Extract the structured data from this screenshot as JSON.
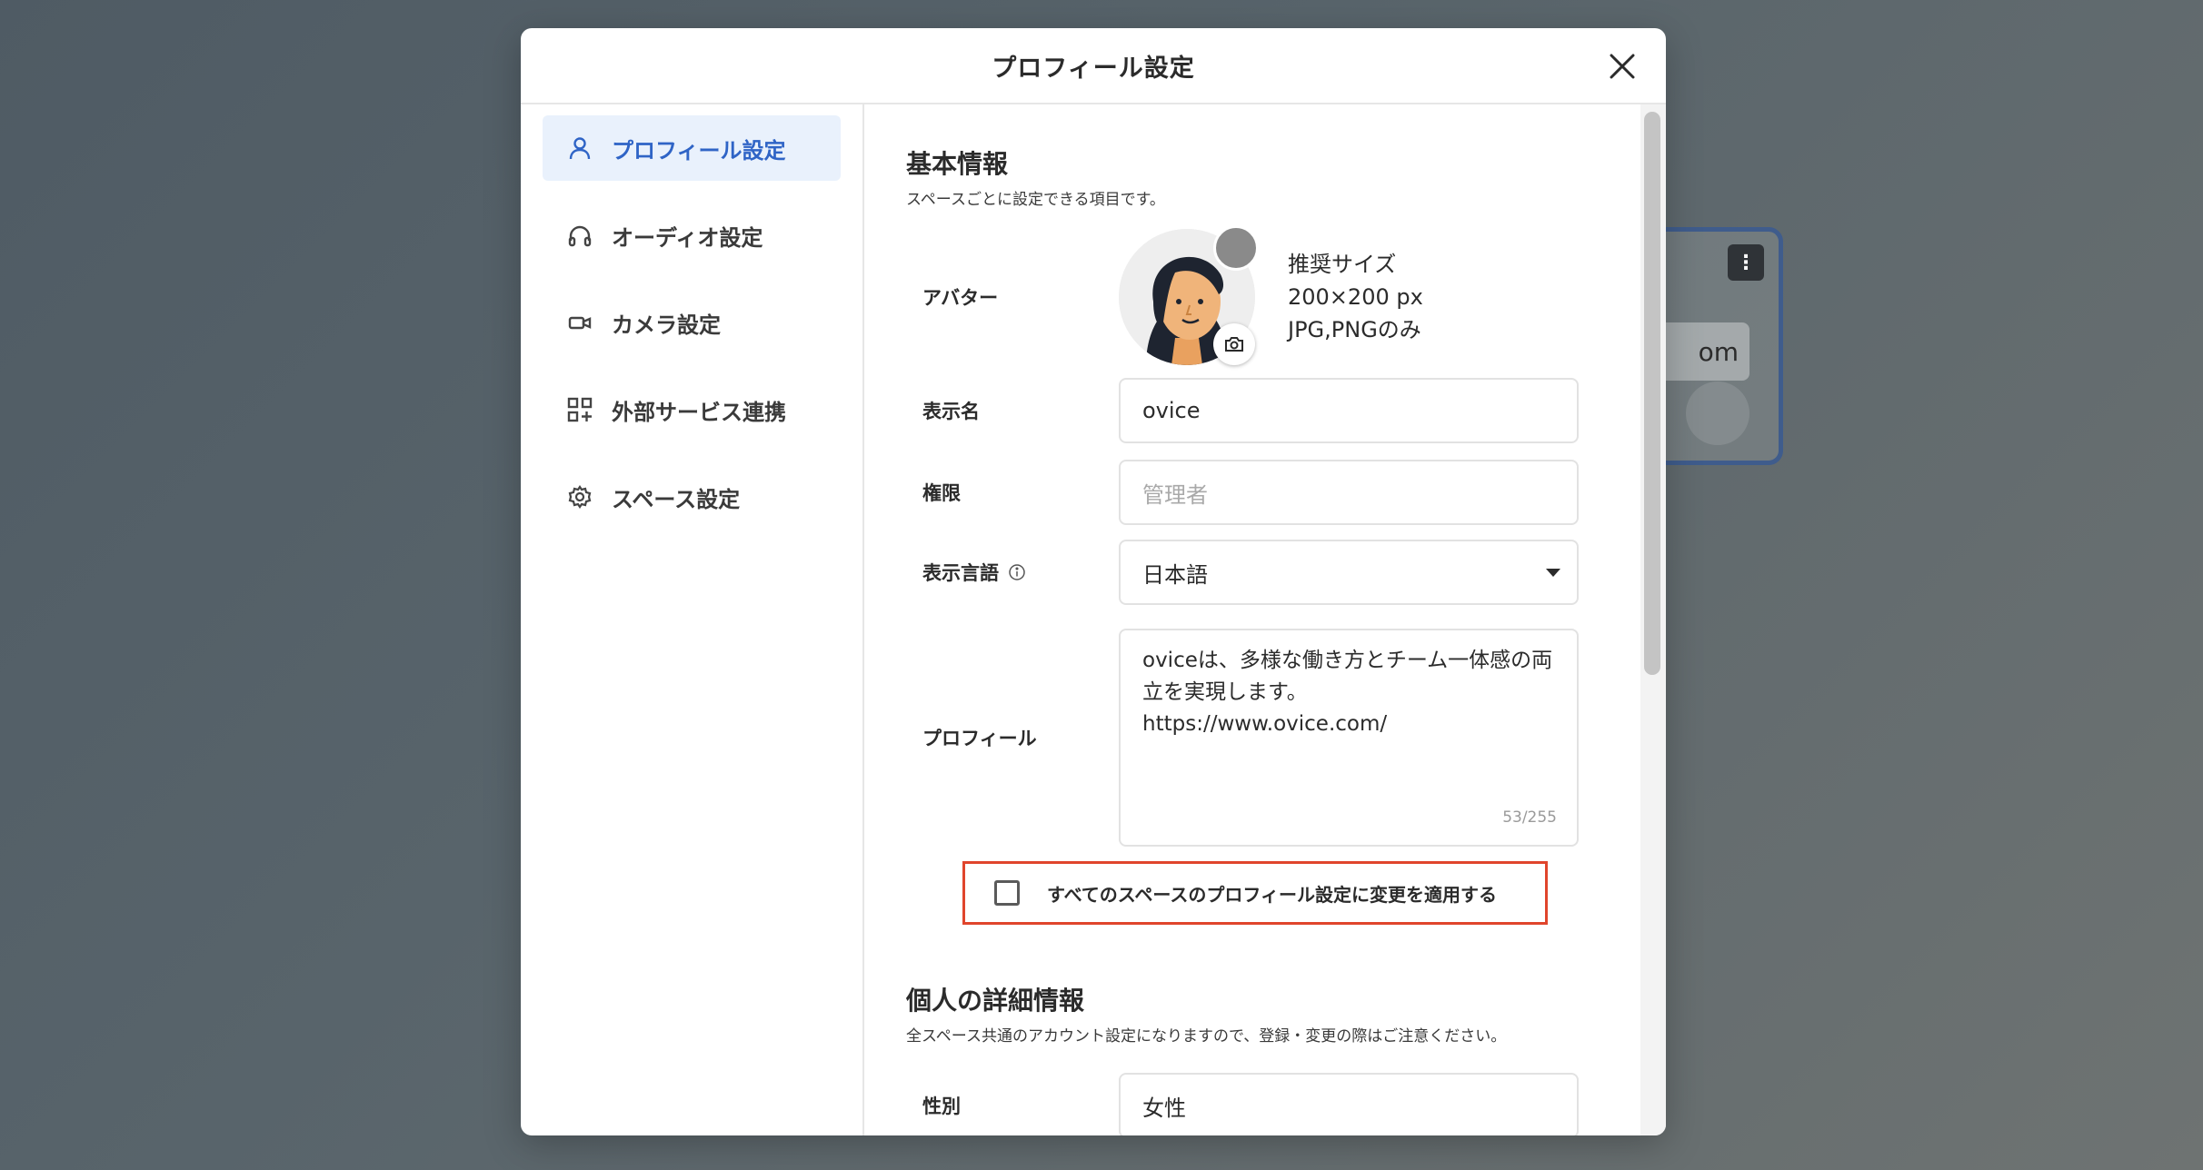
{
  "background": {
    "card_text": "om",
    "card_menu_icon": "more-vertical-icon"
  },
  "modal": {
    "title": "プロフィール設定",
    "close_icon": "close-icon"
  },
  "sidebar": {
    "items": [
      {
        "label": "プロフィール設定",
        "icon": "user-icon",
        "active": true
      },
      {
        "label": "オーディオ設定",
        "icon": "headphones-icon",
        "active": false
      },
      {
        "label": "カメラ設定",
        "icon": "video-camera-icon",
        "active": false
      },
      {
        "label": "外部サービス連携",
        "icon": "apps-add-icon",
        "active": false
      },
      {
        "label": "スペース設定",
        "icon": "gear-icon",
        "active": false
      }
    ]
  },
  "basic": {
    "title": "基本情報",
    "desc": "スペースごとに設定できる項目です。",
    "avatar_label": "アバター",
    "avatar_info": [
      "推奨サイズ",
      "200×200 px",
      "JPG,PNGのみ"
    ],
    "display_name_label": "表示名",
    "display_name_value": "ovice",
    "role_label": "権限",
    "role_placeholder": "管理者",
    "language_label": "表示言語",
    "language_value": "日本語",
    "profile_label": "プロフィール",
    "profile_lines": [
      "oviceは、多様な働き方とチーム一体感の両",
      "立を実現します。",
      "https://www.ovice.com/"
    ],
    "profile_counter": "53/255",
    "apply_all_label": "すべてのスペースのプロフィール設定に変更を適用する",
    "apply_all_checked": false
  },
  "personal": {
    "title": "個人の詳細情報",
    "desc": "全スペース共通のアカウント設定になりますので、登録・変更の際はご注意ください。",
    "gender_label": "性別",
    "gender_value": "女性"
  },
  "colors": {
    "accent": "#2f64c6",
    "active_bg": "#e9f1fc",
    "highlight_border": "#e0452c"
  }
}
